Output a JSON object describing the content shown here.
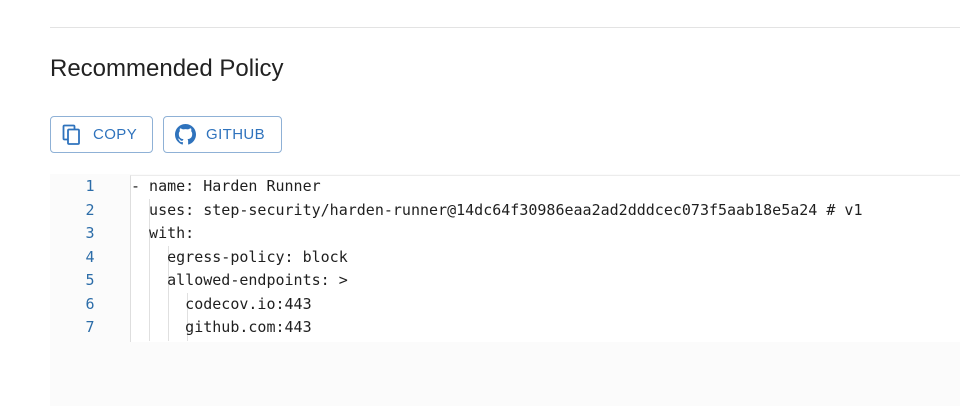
{
  "page": {
    "section_title": "Recommended Policy"
  },
  "toolbar": {
    "copy_label": "COPY",
    "copy_icon": "copy-icon",
    "github_label": "GITHUB",
    "github_icon": "github-icon"
  },
  "code": {
    "line_numbers": [
      "1",
      "2",
      "3",
      "4",
      "5",
      "6",
      "7"
    ],
    "lines": [
      "- name: Harden Runner",
      "  uses: step-security/harden-runner@14dc64f30986eaa2ad2dddcec073f5aab18e5a24 # v1",
      "  with:",
      "    egress-policy: block",
      "    allowed-endpoints: >",
      "      codecov.io:443",
      "      github.com:443"
    ]
  },
  "colors": {
    "accent": "#2f73bd",
    "line_number": "#2b6ca8",
    "button_border": "#8fb1d6"
  }
}
